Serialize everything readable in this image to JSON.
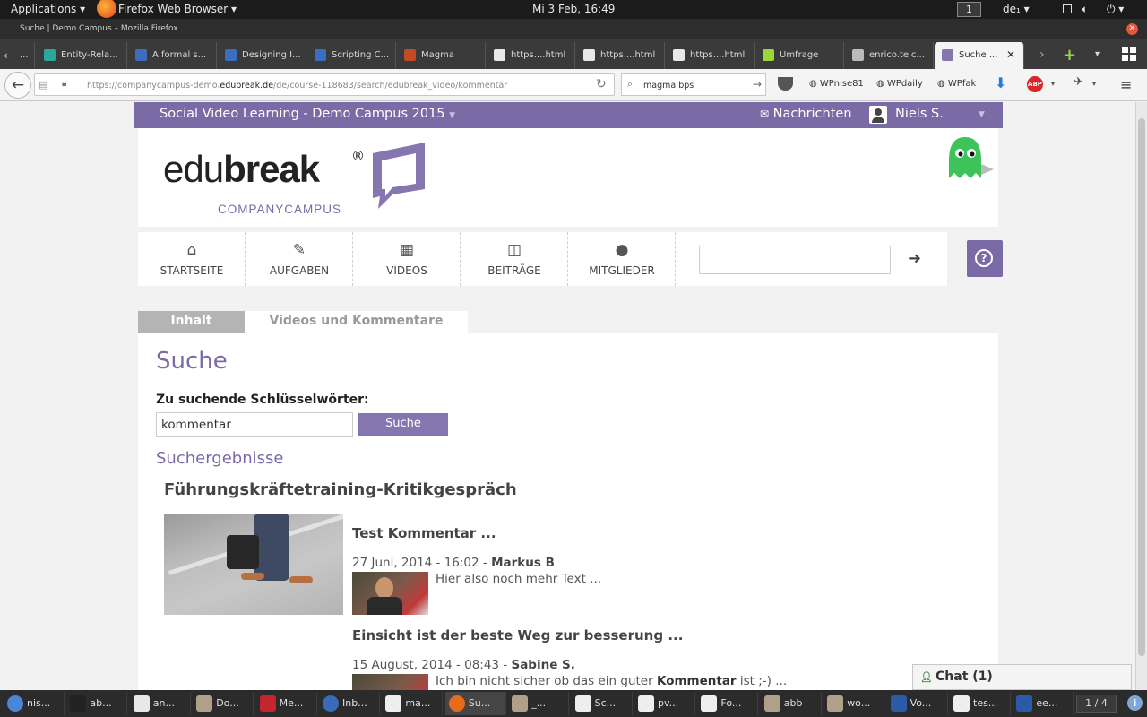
{
  "system": {
    "applications_menu": "Applications",
    "active_app": "Firefox Web Browser",
    "clock": "Mi 3 Feb, 16:49",
    "workspace": "1",
    "keyboard_layout": "de₁"
  },
  "window": {
    "title": "Suche | Demo Campus – Mozilla Firefox"
  },
  "tabs": [
    {
      "label": "...",
      "icon": "page-icon"
    },
    {
      "label": "Entity-Rela...",
      "icon": "researchgate-icon"
    },
    {
      "label": "A formal s...",
      "icon": "loading-icon"
    },
    {
      "label": "Designing I...",
      "icon": "loading-icon"
    },
    {
      "label": "Scripting C...",
      "icon": "loading-icon"
    },
    {
      "label": "Magma",
      "icon": "magma-icon"
    },
    {
      "label": "https....html",
      "icon": "doc-icon"
    },
    {
      "label": "https....html",
      "icon": "doc-icon"
    },
    {
      "label": "https....html",
      "icon": "doc-icon"
    },
    {
      "label": "Umfrage",
      "icon": "leaf-icon"
    },
    {
      "label": "enrico.teic...",
      "icon": "page-icon"
    },
    {
      "label": "Suche ...",
      "icon": "edubreak-icon"
    }
  ],
  "navbar": {
    "url_prefix": "https://companycampus-demo.",
    "url_domain": "edubreak.de",
    "url_path": "/de/course-118683/search/edubreak_video/kommentar",
    "search_value": "magma bps",
    "bookmarks": [
      "WPnise81",
      "WPdaily",
      "WPfak"
    ]
  },
  "site": {
    "campus_name": "Social Video Learning - Demo Campus 2015",
    "messages_label": "Nachrichten",
    "user_name": "Niels S.",
    "logo_edu": "edu",
    "logo_break": "break",
    "logo_reg": "®",
    "logo_sub": "COMPANYCAMPUS",
    "menu": [
      {
        "label": "STARTSEITE",
        "icon": "home-icon",
        "glyph": "⌂"
      },
      {
        "label": "AUFGABEN",
        "icon": "pencil-icon",
        "glyph": "✎"
      },
      {
        "label": "VIDEOS",
        "icon": "film-icon",
        "glyph": "▦"
      },
      {
        "label": "BEITRÄGE",
        "icon": "book-icon",
        "glyph": "◫"
      },
      {
        "label": "MITGLIEDER",
        "icon": "user-icon",
        "glyph": "●"
      }
    ],
    "search_go_icon": "➜",
    "help_icon": "?"
  },
  "content": {
    "tab_inhalt": "Inhalt",
    "tab_videos": "Videos und Kommentare",
    "heading": "Suche",
    "keywords_label": "Zu suchende Schlüsselwörter:",
    "query": "kommentar",
    "search_button": "Suche",
    "results_heading": "Suchergebnisse",
    "video_title": "Führungskräftetraining-Kritikgespräch",
    "results": [
      {
        "title": "Test Kommentar ...",
        "date": "27 Juni, 2014 - 16:02 - ",
        "author": "Markus B",
        "snippet": "Hier also noch mehr Text ..."
      },
      {
        "title": "Einsicht ist der beste Weg zur besserung ...",
        "date": "15 August, 2014 - 08:43 - ",
        "author": "Sabine S.",
        "snippet_before": "Ich bin nicht sicher ob das ein guter ",
        "snippet_highlight": "Kommentar",
        "snippet_after": " ist ;-) ..."
      }
    ],
    "chat_label": "Chat (1)"
  },
  "taskbar": {
    "items": [
      {
        "label": "nis...",
        "icon": "chrome-icon"
      },
      {
        "label": "ab...",
        "icon": "terminal-icon"
      },
      {
        "label": "an...",
        "icon": "editor-icon"
      },
      {
        "label": "Do...",
        "icon": "file-manager-icon"
      },
      {
        "label": "Me...",
        "icon": "mendeley-icon"
      },
      {
        "label": "Inb...",
        "icon": "thunderbird-icon"
      },
      {
        "label": "ma...",
        "icon": "evince-icon"
      },
      {
        "label": "Su...",
        "icon": "firefox-icon"
      },
      {
        "label": "_...",
        "icon": "file-manager-icon"
      },
      {
        "label": "Sc...",
        "icon": "evince-icon"
      },
      {
        "label": "pv...",
        "icon": "evince-icon"
      },
      {
        "label": "Fo...",
        "icon": "evince-icon"
      },
      {
        "label": "abb",
        "icon": "file-manager-icon"
      },
      {
        "label": "wo...",
        "icon": "file-manager-icon"
      },
      {
        "label": "Vo...",
        "icon": "document-icon"
      },
      {
        "label": "tes...",
        "icon": "evince-icon"
      },
      {
        "label": "ee...",
        "icon": "document-icon"
      }
    ],
    "workspace_pager": "1 / 4"
  }
}
